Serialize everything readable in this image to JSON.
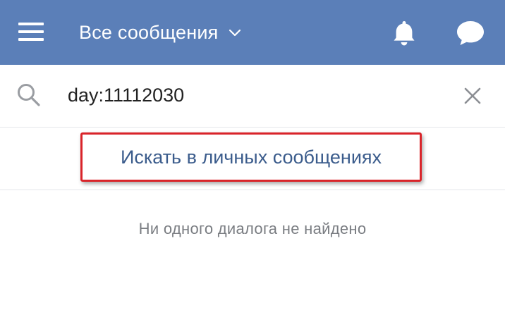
{
  "header": {
    "title": "Все сообщения",
    "menu_icon": "hamburger-menu-icon",
    "dropdown_icon": "chevron-down-icon",
    "notifications_icon": "bell-icon",
    "messages_icon": "chat-bubble-icon",
    "background_color": "#5b7fb8"
  },
  "search": {
    "icon": "search-icon",
    "value": "day:11112030",
    "clear_icon": "close-icon"
  },
  "suggestion": {
    "label": "Искать в личных сообщениях",
    "highlight_color": "#d9242a",
    "text_color": "#3b5c8c"
  },
  "results": {
    "empty_message": "Ни одного диалога не найдено"
  }
}
